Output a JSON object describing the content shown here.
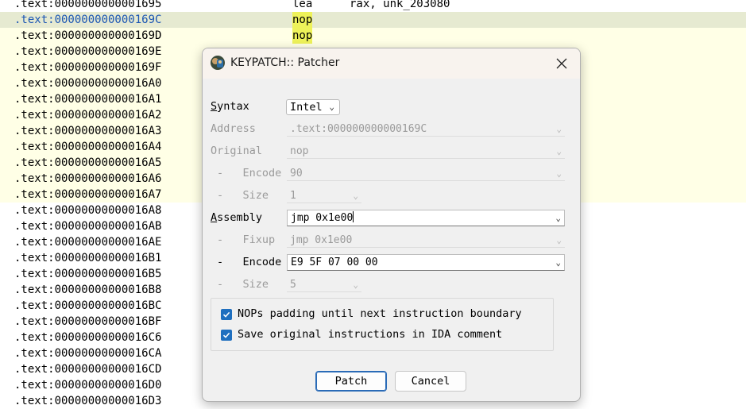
{
  "listing": {
    "rows": [
      {
        "addr": ".text:0000000000001695",
        "mnemonic": "lea",
        "operands": "rax, unk_203080",
        "style": "",
        "sel": false
      },
      {
        "addr": ".text:000000000000169C",
        "mnemonic": "nop",
        "operands": "",
        "style": "cur",
        "sel": true
      },
      {
        "addr": ".text:000000000000169D",
        "mnemonic": "nop",
        "operands": "",
        "style": "hl",
        "sel": true
      },
      {
        "addr": ".text:000000000000169E",
        "mnemonic": "",
        "operands": "",
        "style": "hl",
        "sel": false
      },
      {
        "addr": ".text:000000000000169F",
        "mnemonic": "",
        "operands": "",
        "style": "hl",
        "sel": false
      },
      {
        "addr": ".text:00000000000016A0",
        "mnemonic": "",
        "operands": "",
        "style": "hl",
        "sel": false
      },
      {
        "addr": ".text:00000000000016A1",
        "mnemonic": "",
        "operands": "",
        "style": "hl",
        "sel": false
      },
      {
        "addr": ".text:00000000000016A2",
        "mnemonic": "",
        "operands": "",
        "style": "hl",
        "sel": false
      },
      {
        "addr": ".text:00000000000016A3",
        "mnemonic": "",
        "operands": "",
        "style": "hl",
        "sel": false
      },
      {
        "addr": ".text:00000000000016A4",
        "mnemonic": "",
        "operands": "",
        "style": "hl",
        "sel": false
      },
      {
        "addr": ".text:00000000000016A5",
        "mnemonic": "",
        "operands": "",
        "style": "hl",
        "sel": false
      },
      {
        "addr": ".text:00000000000016A6",
        "mnemonic": "",
        "operands": "",
        "style": "hl",
        "sel": false
      },
      {
        "addr": ".text:00000000000016A7",
        "mnemonic": "",
        "operands": "",
        "style": "hl",
        "sel": false
      },
      {
        "addr": ".text:00000000000016A8",
        "mnemonic": "",
        "operands": "",
        "style": "",
        "sel": false
      },
      {
        "addr": ".text:00000000000016AB",
        "mnemonic": "",
        "operands": "",
        "style": "",
        "sel": false
      },
      {
        "addr": ".text:00000000000016AE",
        "mnemonic": "",
        "operands": "",
        "style": "",
        "sel": false
      },
      {
        "addr": ".text:00000000000016B1",
        "mnemonic": "",
        "operands": "",
        "style": "",
        "sel": false
      },
      {
        "addr": ".text:00000000000016B5",
        "mnemonic": "",
        "operands": "",
        "style": "",
        "sel": false
      },
      {
        "addr": ".text:00000000000016B8",
        "mnemonic": "",
        "operands": "",
        "style": "",
        "sel": false
      },
      {
        "addr": ".text:00000000000016BC",
        "mnemonic": "",
        "operands": "",
        "style": "",
        "sel": false
      },
      {
        "addr": ".text:00000000000016BF",
        "mnemonic": "",
        "operands": "",
        "style": "",
        "sel": false
      },
      {
        "addr": ".text:00000000000016C6",
        "mnemonic": "",
        "operands": "",
        "style": "",
        "sel": false
      },
      {
        "addr": ".text:00000000000016CA",
        "mnemonic": "",
        "operands": "",
        "style": "",
        "sel": false
      },
      {
        "addr": ".text:00000000000016CD",
        "mnemonic": "",
        "operands": "",
        "style": "",
        "sel": false
      },
      {
        "addr": ".text:00000000000016D0",
        "mnemonic": "",
        "operands": "",
        "style": "",
        "sel": false
      },
      {
        "addr": ".text:00000000000016D3",
        "mnemonic": "",
        "operands": "",
        "style": "",
        "sel": false
      }
    ]
  },
  "dialog": {
    "title": "KEYPATCH:: Patcher",
    "syntax_label": "Syntax",
    "syntax_value": "Intel",
    "address_label": "Address",
    "address_value": ".text:000000000000169C",
    "original_label": "Original",
    "original_value": "nop",
    "orig_encode_label": "-   Encode",
    "orig_encode_value": "90",
    "orig_size_label": "-   Size",
    "orig_size_value": "1",
    "assembly_label": "Assembly",
    "assembly_value": "jmp 0x1e00",
    "fixup_label": "-   Fixup",
    "fixup_value": "jmp 0x1e00",
    "encode_label": "-   Encode",
    "encode_value": "E9 5F 07 00 00",
    "size_label": "-   Size",
    "size_value": "5",
    "nop_padding_label": "NOPs padding until next instruction boundary",
    "nop_padding_checked": true,
    "save_comment_label": "Save original instructions in IDA comment",
    "save_comment_checked": true,
    "patch_label": "Patch",
    "cancel_label": "Cancel"
  }
}
